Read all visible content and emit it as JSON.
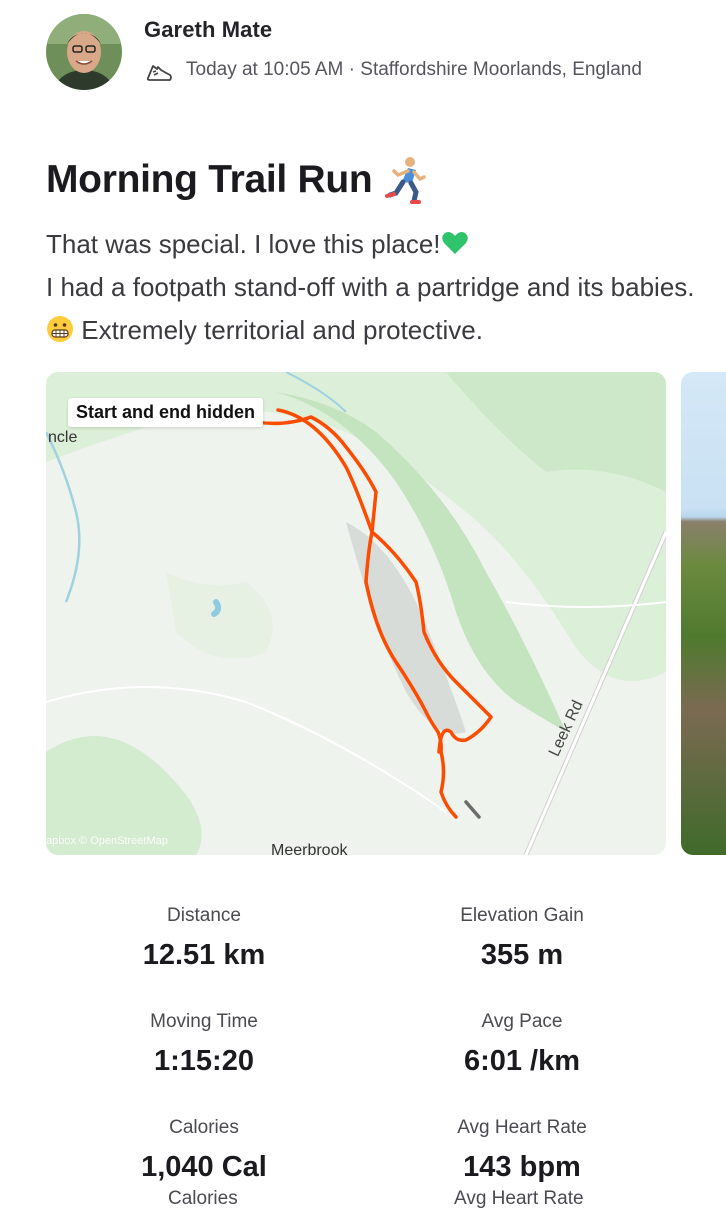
{
  "athlete": {
    "name": "Gareth Mate",
    "meta": "Today at 10:05 AM · Staffordshire Moorlands, England",
    "activity_icon": "running-shoe-icon"
  },
  "activity": {
    "title": "Morning Trail Run",
    "title_emoji": "runner-emoji",
    "description_line1": "That was special. I love this place!",
    "description_line2": "I had a footpath stand-off with a partridge and its babies.",
    "description_line3": "Extremely territorial and protective."
  },
  "map": {
    "badge": "Start and end hidden",
    "place_left": "ncle",
    "road_label": "Leek Rd",
    "place_bottom": "Meerbrook",
    "attribution": "apbox © OpenStreetMap",
    "route_color": "#fc4c02"
  },
  "stats": [
    {
      "label": "Distance",
      "value": "12.51 km"
    },
    {
      "label": "Elevation Gain",
      "value": "355 m"
    },
    {
      "label": "Moving Time",
      "value": "1:15:20"
    },
    {
      "label": "Avg Pace",
      "value": "6:01 /km"
    },
    {
      "label": "Calories",
      "value": "1,040 Cal"
    },
    {
      "label": "Avg Heart Rate",
      "value": "143 bpm"
    }
  ],
  "partial_labels": {
    "left": "Calories",
    "right": "Avg Heart Rate"
  }
}
